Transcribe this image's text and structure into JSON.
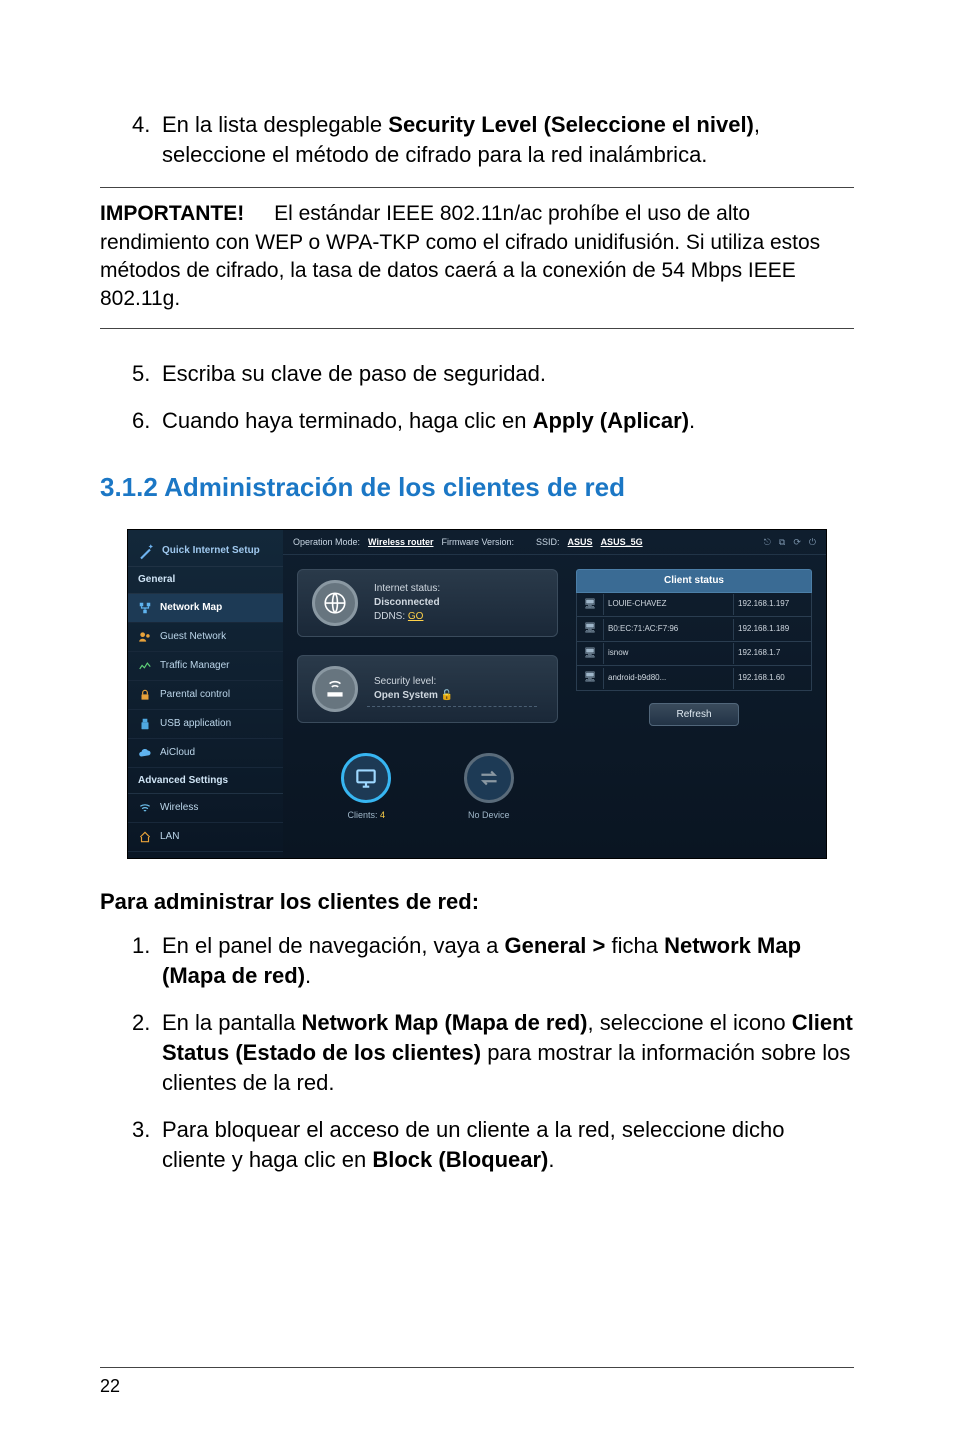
{
  "step4": {
    "num": "4.",
    "pre": "En la lista desplegable ",
    "bold": "Security Level (Seleccione el nivel)",
    "post": ", seleccione el método de cifrado para la red inalámbrica."
  },
  "note": {
    "label": "IMPORTANTE!",
    "text": " El estándar IEEE 802.11n/ac prohíbe el uso de alto rendimiento con WEP o WPA-TKP como el cifrado unidifusión. Si utiliza estos métodos de cifrado, la tasa de datos caerá a la conexión de 54 Mbps IEEE 802.11g."
  },
  "step5": {
    "num": "5.",
    "text": "Escriba su clave de paso de seguridad."
  },
  "step6": {
    "num": "6.",
    "pre": "Cuando haya terminado, haga clic en ",
    "bold": "Apply (Aplicar)",
    "post": "."
  },
  "section_title": "3.1.2  Administración de los clientes de red",
  "screenshot": {
    "qis": "Quick Internet Setup",
    "general": "General",
    "sidebar": [
      "Network Map",
      "Guest Network",
      "Traffic Manager",
      "Parental control",
      "USB application",
      "AiCloud"
    ],
    "adv_head": "Advanced Settings",
    "adv_items": [
      "Wireless",
      "LAN"
    ],
    "topbar": {
      "opmode_label": "Operation Mode:",
      "opmode_value": "Wireless router",
      "fw_label": "Firmware Version:",
      "ssid_label": "SSID:",
      "ssid1": "ASUS",
      "ssid2": "ASUS_5G"
    },
    "card1": {
      "l1": "Internet status:",
      "l2": "Disconnected",
      "l3": "DDNS: ",
      "link": "GO"
    },
    "card2": {
      "l1": "Security level:",
      "l2": "Open System "
    },
    "mini1": {
      "label": "Clients: ",
      "count": "4"
    },
    "mini2": {
      "label": "No Device"
    },
    "client_head": "Client status",
    "clients": [
      {
        "name": "LOUIE-CHAVEZ",
        "ip": "192.168.1.197"
      },
      {
        "name": "B0:EC:71:AC:F7:96",
        "ip": "192.168.1.189"
      },
      {
        "name": "isnow",
        "ip": "192.168.1.7"
      },
      {
        "name": "android-b9d80...",
        "ip": "192.168.1.60"
      }
    ],
    "refresh": "Refresh"
  },
  "sub_title": "Para administrar los clientes de red:",
  "p1": {
    "num": "1.",
    "pre": "En el panel de navegación, vaya a ",
    "b1": "General > ",
    "mid": "ficha ",
    "b2": "Network Map (Mapa de red)",
    "post": "."
  },
  "p2": {
    "num": "2.",
    "pre": "En la pantalla ",
    "b1": "Network Map (Mapa de red)",
    "mid": ", seleccione el icono ",
    "b2": "Client Status (Estado de los clientes)",
    "post": " para mostrar la información sobre los clientes de la red."
  },
  "p3": {
    "num": "3.",
    "pre": "Para bloquear el acceso de un cliente a la red, seleccione dicho cliente y haga clic en ",
    "b1": "Block (Bloquear)",
    "post": "."
  },
  "pagenum": "22"
}
